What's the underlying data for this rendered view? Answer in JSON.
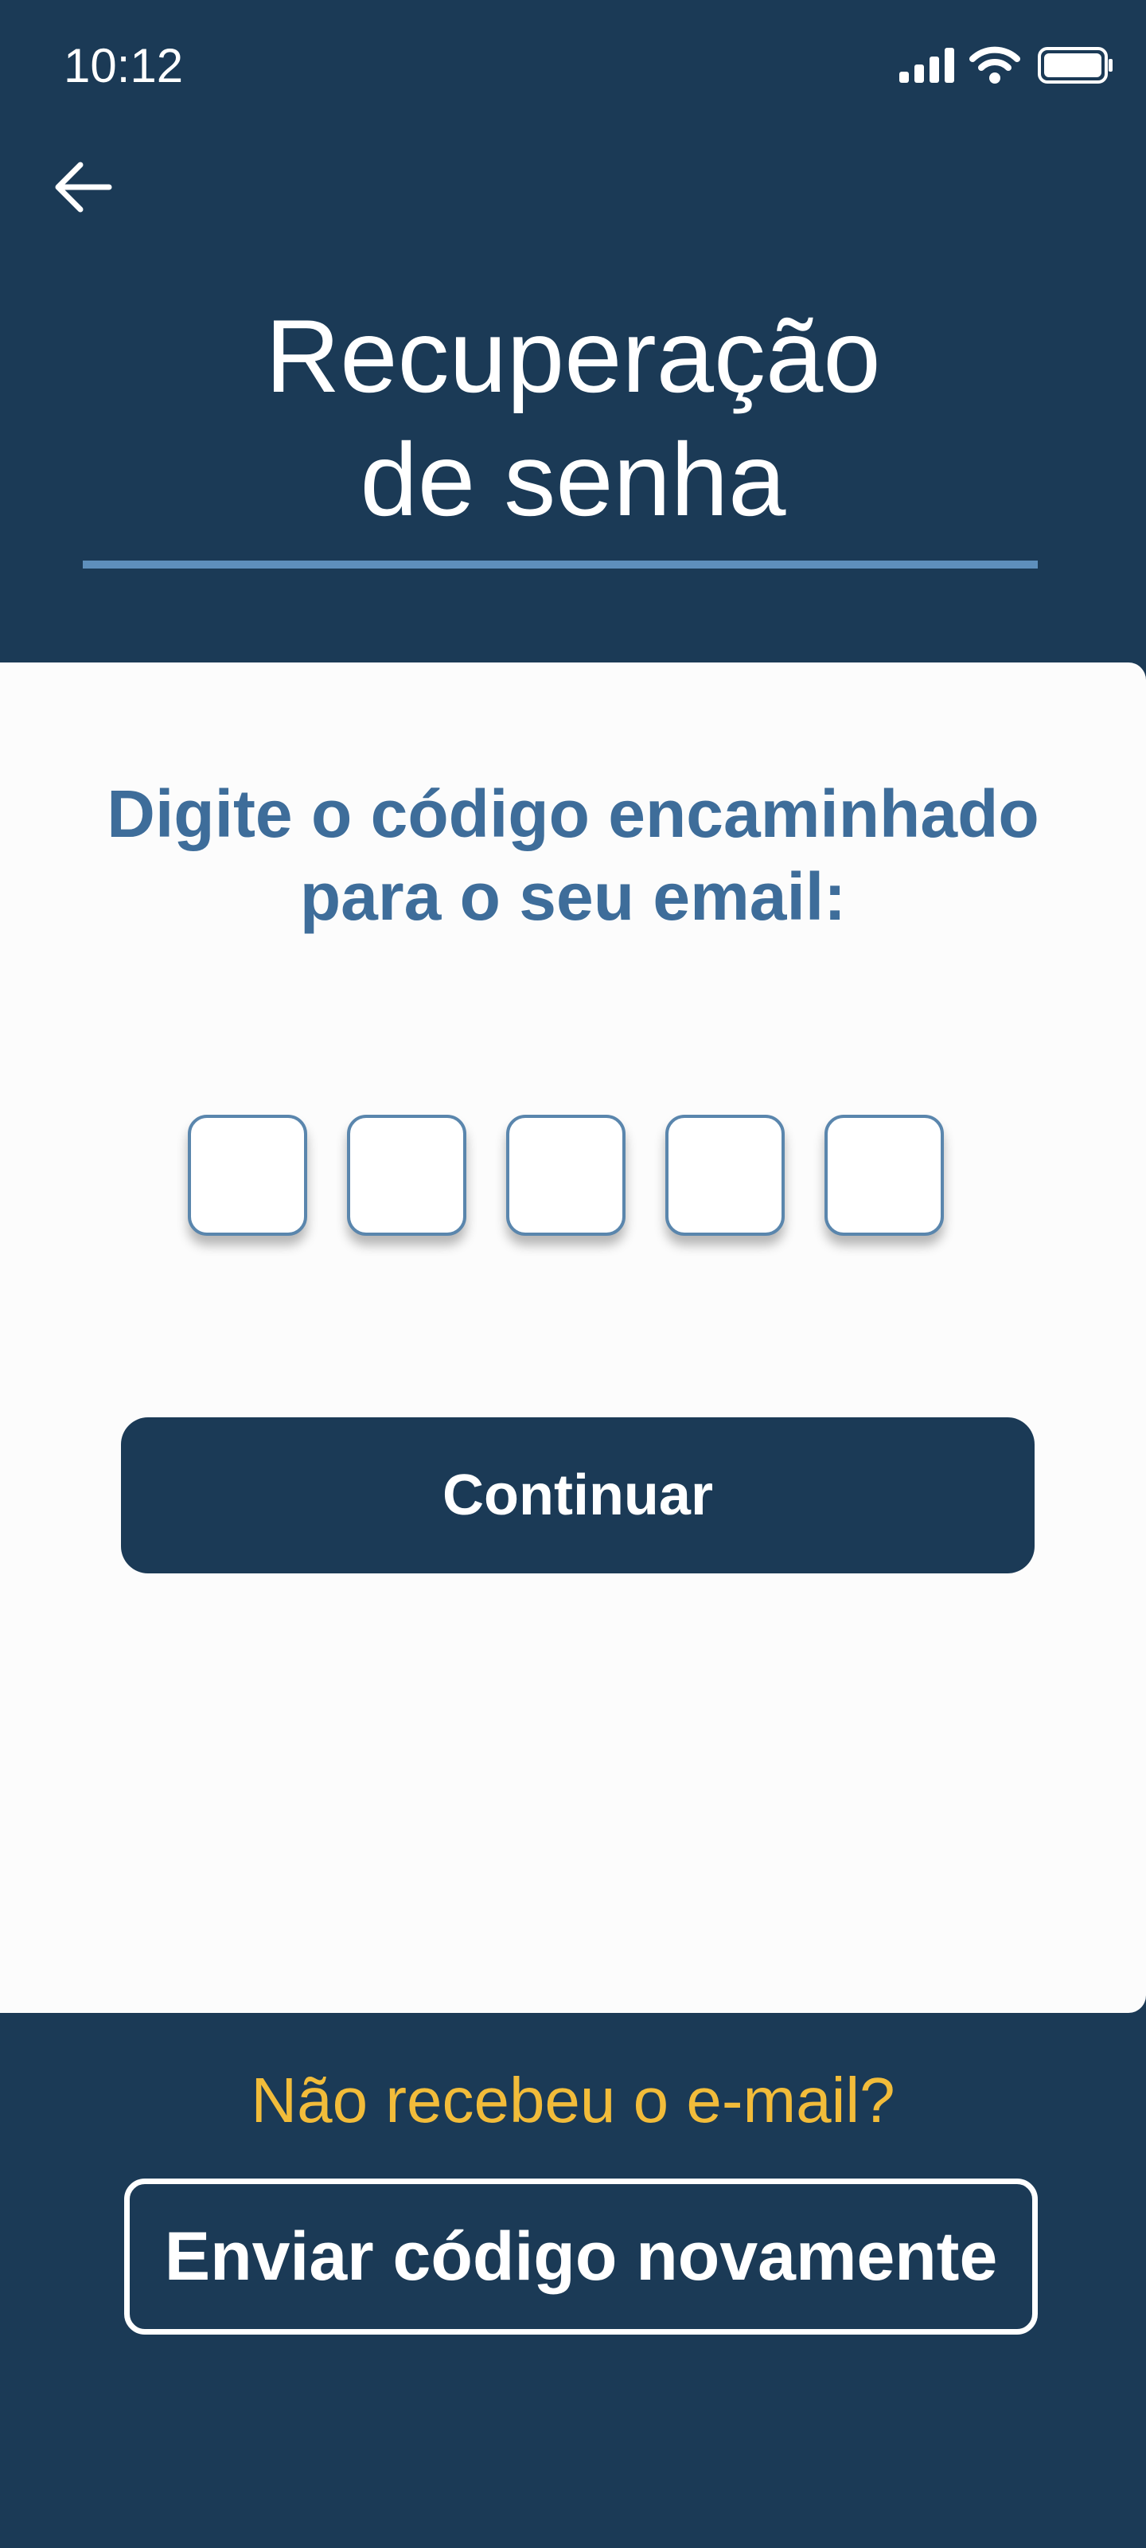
{
  "status_bar": {
    "time": "10:12",
    "icons": [
      "signal-icon",
      "wifi-icon",
      "battery-icon"
    ]
  },
  "header": {
    "back_icon": "arrow-left-icon",
    "title_line1": "Recuperação",
    "title_line2": "de senha"
  },
  "main": {
    "instruction_line1": "Digite o código encaminhado",
    "instruction_line2": "para o seu email:",
    "code_digits": [
      "",
      "",
      "",
      "",
      ""
    ],
    "continue_label": "Continuar"
  },
  "footer": {
    "question": "Não recebeu o e-mail?",
    "resend_label": "Enviar código novamente"
  },
  "colors": {
    "primary": "#1b3a56",
    "accent": "#5e8fbc",
    "instruction_text": "#3e6d9a",
    "highlight": "#f2bc3a",
    "card_background": "#fcfcfc"
  }
}
